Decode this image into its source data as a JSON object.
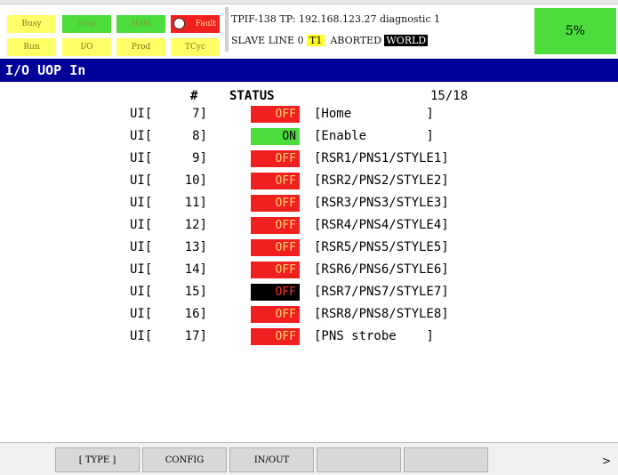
{
  "status_indicators": [
    {
      "label": "Busy",
      "color": "yellow"
    },
    {
      "label": "Step",
      "color": "green"
    },
    {
      "label": "Hold",
      "color": "green"
    },
    {
      "label": "Fault",
      "color": "red"
    },
    {
      "label": "Run",
      "color": "yellow"
    },
    {
      "label": "I/O",
      "color": "yellow"
    },
    {
      "label": "Prod",
      "color": "yellow"
    },
    {
      "label": "TCyc",
      "color": "yellow"
    }
  ],
  "message": {
    "line1": "TPIF-138 TP: 192.168.123.27 diagnostic 1",
    "line2_prefix": "SLAVE LINE 0",
    "mode": "T1",
    "status": "ABORTED",
    "frame": "WORLD"
  },
  "override": "5%",
  "screen_title": "I/O UOP In",
  "table": {
    "col_number": "#",
    "col_status": "STATUS",
    "page": "15/18",
    "rows": [
      {
        "type": "UI[",
        "num": "7]",
        "status": "OFF",
        "state": "off",
        "comment": "[Home          ]"
      },
      {
        "type": "UI[",
        "num": "8]",
        "status": "ON",
        "state": "on",
        "comment": "[Enable        ]"
      },
      {
        "type": "UI[",
        "num": "9]",
        "status": "OFF",
        "state": "off",
        "comment": "[RSR1/PNS1/STYLE1]"
      },
      {
        "type": "UI[",
        "num": "10]",
        "status": "OFF",
        "state": "off",
        "comment": "[RSR2/PNS2/STYLE2]"
      },
      {
        "type": "UI[",
        "num": "11]",
        "status": "OFF",
        "state": "off",
        "comment": "[RSR3/PNS3/STYLE3]"
      },
      {
        "type": "UI[",
        "num": "12]",
        "status": "OFF",
        "state": "off",
        "comment": "[RSR4/PNS4/STYLE4]"
      },
      {
        "type": "UI[",
        "num": "13]",
        "status": "OFF",
        "state": "off",
        "comment": "[RSR5/PNS5/STYLE5]"
      },
      {
        "type": "UI[",
        "num": "14]",
        "status": "OFF",
        "state": "off",
        "comment": "[RSR6/PNS6/STYLE6]"
      },
      {
        "type": "UI[",
        "num": "15]",
        "status": "OFF",
        "state": "selected",
        "comment": "[RSR7/PNS7/STYLE7]"
      },
      {
        "type": "UI[",
        "num": "16]",
        "status": "OFF",
        "state": "off",
        "comment": "[RSR8/PNS8/STYLE8]"
      },
      {
        "type": "UI[",
        "num": "17]",
        "status": "OFF",
        "state": "off",
        "comment": "[PNS strobe    ]"
      }
    ]
  },
  "softkeys": [
    "[ TYPE ]",
    "CONFIG",
    "IN/OUT",
    "",
    ""
  ],
  "next_key": ">",
  "colors": {
    "title_bar": "#000099",
    "off": "#f02020",
    "on": "#4cdc3c",
    "indicator_yellow": "#ffff66",
    "indicator_green": "#4cdc3c",
    "mode_highlight": "#ffff22"
  }
}
